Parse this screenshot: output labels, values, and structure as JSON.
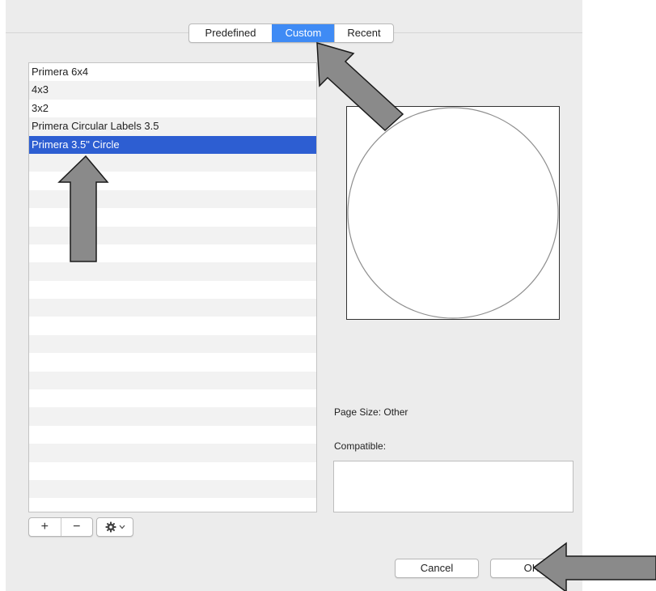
{
  "tabs": [
    {
      "label": "Predefined",
      "selected": false
    },
    {
      "label": "Custom",
      "selected": true
    },
    {
      "label": "Recent",
      "selected": false
    }
  ],
  "sizes_list": {
    "items": [
      "Primera 6x4",
      "4x3",
      "3x2",
      "Primera Circular Labels 3.5",
      "Primera 3.5\" Circle"
    ],
    "selected_index": 4
  },
  "page_size_label": "Page Size: Other",
  "compatible_label": "Compatible:",
  "list_controls": {
    "add_label": "+",
    "remove_label": "−",
    "gear_icon": "gear-icon",
    "chevron_icon": "chevron-down-icon"
  },
  "buttons": {
    "cancel_label": "Cancel",
    "ok_label": "OK"
  },
  "colors": {
    "selection_blue": "#2d5ed2",
    "tab_selected_blue": "#3f8bf5",
    "annotation_arrow": "#8a8a8a"
  }
}
